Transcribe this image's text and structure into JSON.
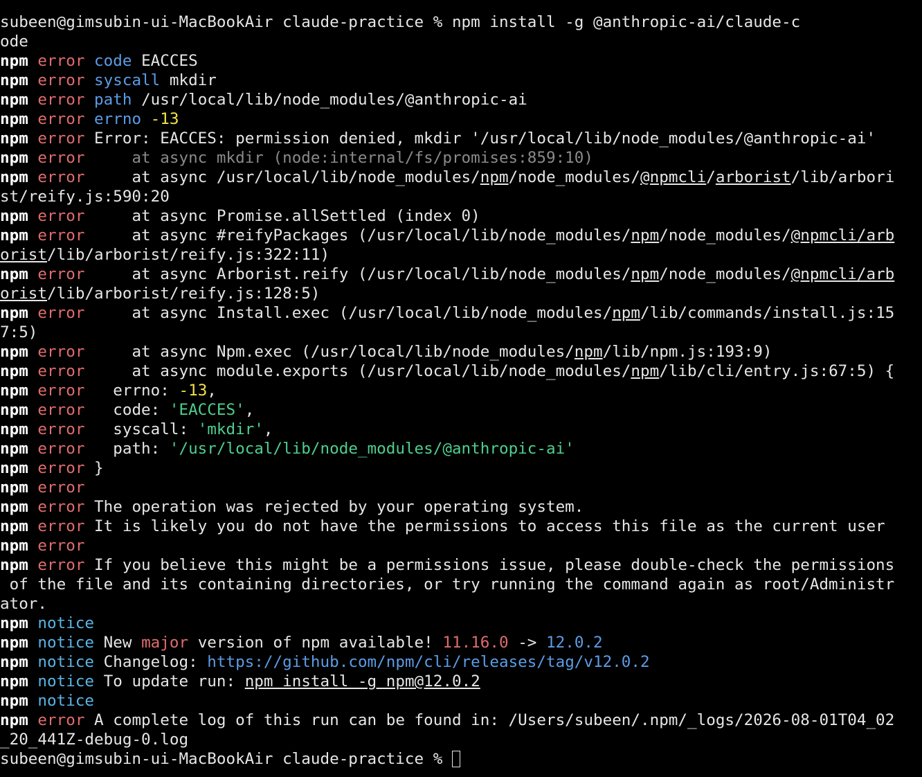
{
  "terminal": {
    "prompt": "subeen@gimsubin-ui-MacBookAir claude-practice % ",
    "command": "npm install -g @anthropic-ai/claude-c",
    "command_wrap": "ode",
    "npm": "npm",
    "error": "error",
    "notice": "notice",
    "code_key": "code",
    "code_val": "EACCES",
    "syscall_key": "syscall",
    "syscall_val": "mkdir",
    "path_key": "path",
    "path_val": "/usr/local/lib/node_modules/@anthropic-ai",
    "errno_key": "errno",
    "errno_val": "-13",
    "error_msg": "Error: EACCES: permission denied, mkdir '/usr/local/lib/node_modules/@anthropic-ai'",
    "stack": {
      "s1": "    at async mkdir (node:internal/fs/promises:859:10)",
      "s2a": "    at async /usr/local/lib/node_modules/",
      "s2b": "/node_modules/",
      "s2c": "/lib/arbori",
      "s2wrap": "st/reify.js:590:20",
      "s3": "    at async Promise.allSettled (index 0)",
      "s4a": "    at async #reifyPackages (/usr/local/lib/node_modules/",
      "s4b": "/node_modules/",
      "s4wrap_a": "orist",
      "s4wrap_b": "/lib/arborist/reify.js:322:11)",
      "s5a": "    at async Arborist.reify (/usr/local/lib/node_modules/",
      "s5b": "/node_modules/",
      "s5wrap_a": "orist",
      "s5wrap_b": "/lib/arborist/reify.js:128:5)",
      "s6a": "    at async Install.exec (/usr/local/lib/node_modules/",
      "s6b": "/lib/commands/install.js:15",
      "s6wrap": "7:5)",
      "s7a": "    at async Npm.exec (/usr/local/lib/node_modules/",
      "s7b": "/lib/npm.js:193:9)",
      "s8a": "    at async module.exports (/usr/local/lib/node_modules/",
      "s8b": "/lib/cli/entry.js:67:5) {",
      "npm_link": "npm",
      "npmcli_link": "@npmcli",
      "arborist_link": "arborist",
      "arb_link": "@npmcli/arb"
    },
    "obj": {
      "errno_key": "  errno: ",
      "errno_val": "-13",
      "errno_end": ",",
      "code_key": "  code: ",
      "code_val": "'EACCES'",
      "code_end": ",",
      "syscall_key": "  syscall: ",
      "syscall_val": "'mkdir'",
      "syscall_end": ",",
      "path_key": "  path: ",
      "path_val": "'/usr/local/lib/node_modules/@anthropic-ai'",
      "close": "}"
    },
    "msg_rejected": "The operation was rejected by your operating system.",
    "msg_likely": "It is likely you do not have the permissions to access this file as the current user",
    "msg_believe": "If you believe this might be a permissions issue, please double-check the permissions",
    "msg_believe_wrap1": " of the file and its containing directories, or try running the command again as root/Administr",
    "msg_believe_wrap2": "ator.",
    "notice_new": "New ",
    "notice_major": "major",
    "notice_version": " version of npm available! ",
    "version_old": "11.16.0",
    "version_arrow": " -> ",
    "version_new": "12.0.2",
    "changelog_label": "Changelog: ",
    "changelog_url": "https://github.com/npm/cli/releases/tag/v12.0.2",
    "update_label": "To update run: ",
    "update_cmd": "npm install -g npm@12.0.2",
    "log_msg": "A complete log of this run can be found in: /Users/subeen/.npm/_logs/2026-08-01T04_02",
    "log_wrap": "_20_441Z-debug-0.log",
    "final_prompt": "subeen@gimsubin-ui-MacBookAir claude-practice % "
  },
  "colors": {
    "background": "#000000",
    "text": "#e6e6e6",
    "error": "#e06c6c",
    "key": "#5c9ce6",
    "number": "#f2e24a",
    "string": "#4fcf8e",
    "notice": "#5ab4e6"
  }
}
